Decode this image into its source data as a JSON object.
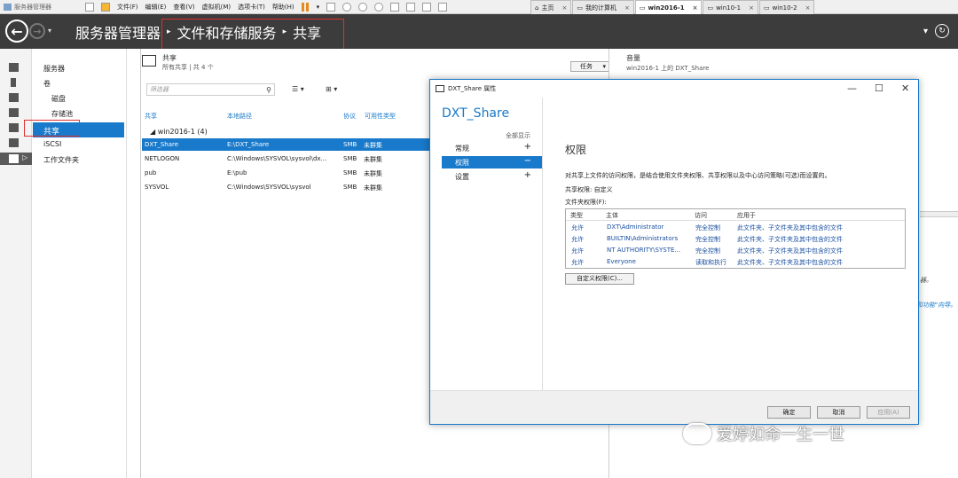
{
  "vmbar": {
    "app_title": "服务器管理器",
    "menu": [
      "文件(F)",
      "编辑(E)",
      "查看(V)",
      "虚拟机(M)",
      "选项卡(T)",
      "帮助(H)"
    ],
    "tabs": [
      {
        "label": "主页",
        "active": false
      },
      {
        "label": "我的计算机",
        "active": false
      },
      {
        "label": "win2016-1",
        "active": true
      },
      {
        "label": "win10-1",
        "active": false
      },
      {
        "label": "win10-2",
        "active": false
      }
    ]
  },
  "header": {
    "breadcrumb": [
      "服务器管理器",
      "文件和存储服务",
      "共享"
    ],
    "refresh_icon": "refresh-icon",
    "dropdown": "▾"
  },
  "nav": {
    "items": [
      {
        "label": "服务器",
        "sub": false
      },
      {
        "label": "卷",
        "sub": false
      },
      {
        "label": "磁盘",
        "sub": true
      },
      {
        "label": "存储池",
        "sub": true
      },
      {
        "label": "共享",
        "sub": false,
        "selected": true
      },
      {
        "label": "iSCSI",
        "sub": false
      },
      {
        "label": "工作文件夹",
        "sub": false
      }
    ]
  },
  "shares": {
    "title": "共享",
    "subtitle": "所有共享 | 共 4 个",
    "tasks_label": "任务",
    "filter_placeholder": "筛选器",
    "columns": [
      "共享",
      "本地路径",
      "协议",
      "可用性类型"
    ],
    "group_label": "win2016-1 (4)",
    "rows": [
      {
        "share": "DXT_Share",
        "path": "E:\\DXT_Share",
        "protocol": "SMB",
        "availability": "未群集",
        "selected": true
      },
      {
        "share": "NETLOGON",
        "path": "C:\\Windows\\SYSVOL\\sysvol\\dx...",
        "protocol": "SMB",
        "availability": "未群集",
        "selected": false
      },
      {
        "share": "pub",
        "path": "E:\\pub",
        "protocol": "SMB",
        "availability": "未群集",
        "selected": false
      },
      {
        "share": "SYSVOL",
        "path": "C:\\Windows\\SYSVOL\\sysvol",
        "protocol": "SMB",
        "availability": "未群集",
        "selected": false
      }
    ]
  },
  "volume": {
    "title": "音量",
    "subtitle": "win2016-1 上的 DXT_Share",
    "fragment1": "器。",
    "fragment2": "和功能\"向导。"
  },
  "dialog": {
    "title": "DXT_Share 属性",
    "share_name": "DXT_Share",
    "show_all": "全部显示",
    "sections": [
      {
        "label": "常规",
        "toggle": "+",
        "selected": false
      },
      {
        "label": "权限",
        "toggle": "−",
        "selected": true
      },
      {
        "label": "设置",
        "toggle": "+",
        "selected": false
      }
    ],
    "perm_title": "权限",
    "perm_desc": "对共享上文件的访问权限，是结合使用文件夹权限、共享权限以及中心访问策略(可选)而设置的。",
    "share_perm": "共享权限: 自定义",
    "folder_perm": "文件夹权限(F):",
    "perm_columns": [
      "类型",
      "主体",
      "访问",
      "应用于"
    ],
    "perm_rows": [
      {
        "type": "允许",
        "principal": "DXT\\Administrator",
        "access": "完全控制",
        "apply": "此文件夹、子文件夹及其中包含的文件"
      },
      {
        "type": "允许",
        "principal": "BUILTIN\\Administrators",
        "access": "完全控制",
        "apply": "此文件夹、子文件夹及其中包含的文件"
      },
      {
        "type": "允许",
        "principal": "NT AUTHORITY\\SYSTE...",
        "access": "完全控制",
        "apply": "此文件夹、子文件夹及其中包含的文件"
      },
      {
        "type": "允许",
        "principal": "Everyone",
        "access": "读取和执行",
        "apply": "此文件夹、子文件夹及其中包含的文件"
      }
    ],
    "custom_btn": "自定义权限(C)...",
    "ok": "确定",
    "cancel": "取消",
    "apply": "应用(A)"
  },
  "watermark": "爱婷如命一生一世",
  "colors": {
    "accent": "#1979ca",
    "header_bg": "#3c3c3c",
    "highlight_red": "#e03030"
  }
}
